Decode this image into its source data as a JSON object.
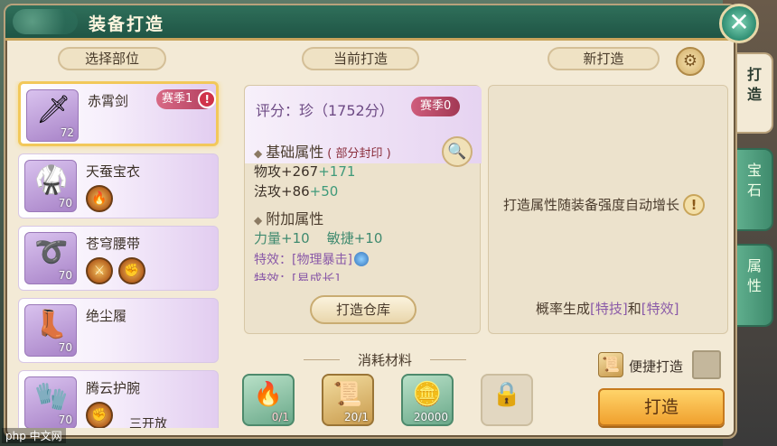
{
  "window": {
    "title": "装备打造",
    "close_glyph": "✕"
  },
  "side_tabs": [
    {
      "label": "打\n造",
      "active": true
    },
    {
      "label": "宝\n石",
      "active": false
    },
    {
      "label": "属\n性",
      "active": false
    }
  ],
  "headers": {
    "select_part": "选择部位",
    "current_forge": "当前打造",
    "new_forge": "新打造",
    "materials": "消耗材料"
  },
  "equipment_list": [
    {
      "name": "赤霄剑",
      "level": "72",
      "icon": "sword-icon",
      "glyph": "🗡",
      "season_badge": "赛季1",
      "alert": "!",
      "selected": true
    },
    {
      "name": "天蚕宝衣",
      "level": "70",
      "icon": "armor-icon",
      "glyph": "🥋",
      "gems": [
        "🔥"
      ]
    },
    {
      "name": "苍穹腰带",
      "level": "70",
      "icon": "belt-icon",
      "glyph": "➰",
      "gems": [
        "⚔",
        "✊"
      ]
    },
    {
      "name": "绝尘履",
      "level": "70",
      "icon": "boots-icon",
      "glyph": "👢",
      "gems": []
    },
    {
      "name": "腾云护腕",
      "level": "70",
      "icon": "bracer-icon",
      "glyph": "🧤",
      "gems": [
        "✊"
      ],
      "partial_label": "三开放"
    }
  ],
  "current": {
    "score": "评分：珍（1752分）",
    "season_badge": "赛季0",
    "base_title": "基础属性",
    "base_note": "( 部分封印 )",
    "stats": [
      {
        "label": "物攻+267",
        "bonus": "+171"
      },
      {
        "label": "法攻+86",
        "bonus": "+50"
      }
    ],
    "extra_title": "附加属性",
    "extra_stats": "力量+10    敏捷+10",
    "effects": [
      "特效：[物理暴击]",
      "特效：[易成长]"
    ],
    "warehouse_button": "打造仓库"
  },
  "new_forge": {
    "hint": "打造属性随装备强度自动增长",
    "info_glyph": "!",
    "prob_prefix": "概率生成",
    "prob_skill": "[特技]",
    "prob_and": "和",
    "prob_effect": "[特效]"
  },
  "materials": [
    {
      "icon": "fire-orb-icon",
      "glyph": "🔥",
      "count": "0/1",
      "style": "green"
    },
    {
      "icon": "scroll-icon",
      "glyph": "📜",
      "count": "20/1",
      "style": "gold"
    },
    {
      "icon": "coin-icon",
      "glyph": "🪙",
      "count": "20000",
      "style": "green"
    },
    {
      "icon": "lock-icon",
      "glyph": "🔒",
      "count": "",
      "style": "locked"
    }
  ],
  "quick_forge_label": "便捷打造",
  "forge_button": "打造",
  "watermark": "php 中文网"
}
